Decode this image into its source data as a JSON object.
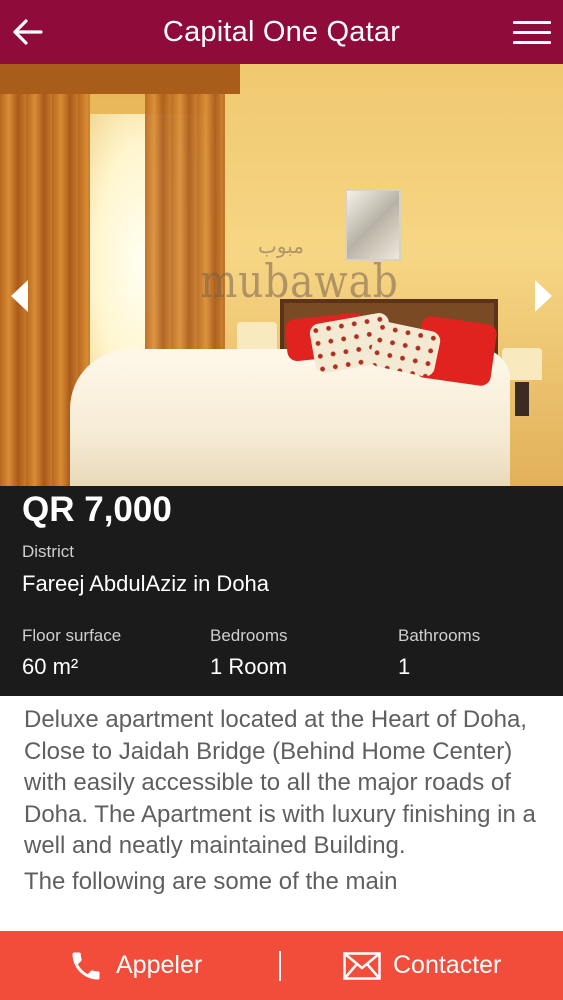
{
  "header": {
    "title": "Capital One Qatar",
    "back_icon": "back-arrow-icon",
    "menu_icon": "hamburger-menu-icon"
  },
  "gallery": {
    "watermark_arabic": "مبوب",
    "watermark_latin": "mubawab",
    "prev_icon": "chevron-left-icon",
    "next_icon": "chevron-right-icon"
  },
  "listing": {
    "price": "QR 7,000",
    "district_label": "District",
    "district_value": "Fareej AbdulAziz in Doha",
    "floor_label": "Floor surface",
    "floor_value": "60 m²",
    "bedrooms_label": "Bedrooms",
    "bedrooms_value": "1 Room",
    "bathrooms_label": "Bathrooms",
    "bathrooms_value": "1"
  },
  "description": {
    "paragraph_1": "Deluxe apartment located at the Heart of Doha, Close to Jaidah Bridge (Behind Home Center) with easily accessible to all the major roads of Doha. The Apartment is with luxury finishing in a well and neatly maintained Building.",
    "paragraph_2": "The following are some of the main"
  },
  "actions": {
    "call_label": "Appeler",
    "call_icon": "phone-icon",
    "contact_label": "Contacter",
    "contact_icon": "envelope-icon",
    "divider": "|"
  },
  "colors": {
    "header_bg": "#8e0b3a",
    "details_bg": "#1b1b1b",
    "action_bar_bg": "#f24d3a"
  }
}
